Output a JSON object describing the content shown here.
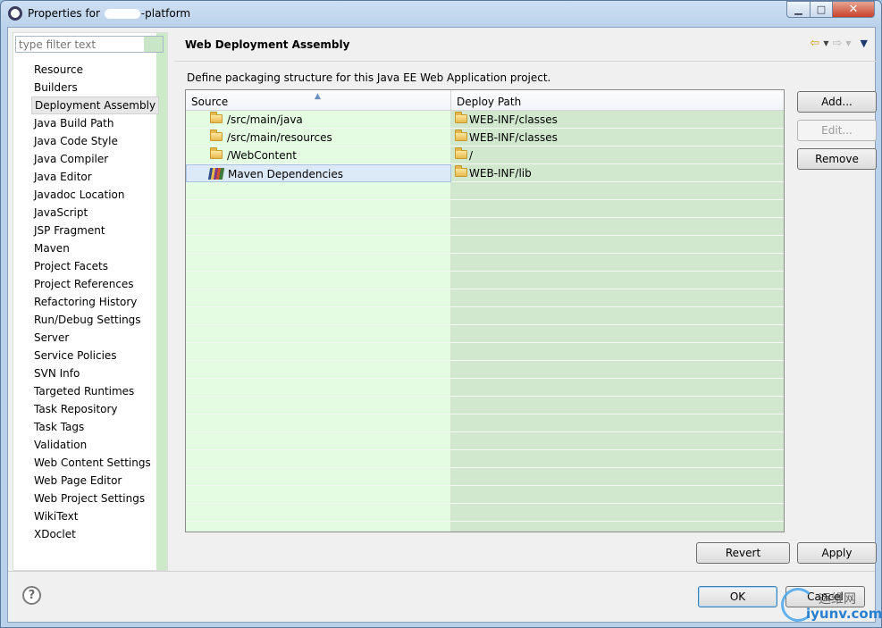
{
  "window": {
    "title_prefix": "Properties for",
    "title_suffix": "-platform",
    "controls": {
      "minimize": "▁",
      "maximize": "□",
      "close": "✕"
    }
  },
  "left_nav": {
    "filter_placeholder": "type filter text",
    "items": [
      "Resource",
      "Builders",
      "Deployment Assembly",
      "Java Build Path",
      "Java Code Style",
      "Java Compiler",
      "Java Editor",
      "Javadoc Location",
      "JavaScript",
      "JSP Fragment",
      "Maven",
      "Project Facets",
      "Project References",
      "Refactoring History",
      "Run/Debug Settings",
      "Server",
      "Service Policies",
      "SVN Info",
      "Targeted Runtimes",
      "Task Repository",
      "Task Tags",
      "Validation",
      "Web Content Settings",
      "Web Page Editor",
      "Web Project Settings",
      "WikiText",
      "XDoclet"
    ],
    "selected": "Deployment Assembly"
  },
  "page": {
    "title": "Web Deployment Assembly",
    "description": "Define packaging structure for this Java EE Web Application project.",
    "nav_icons": {
      "back": "back-arrow-icon",
      "forward": "forward-arrow-icon",
      "menu": "view-menu-icon"
    }
  },
  "table": {
    "columns": {
      "source": "Source",
      "deploy_path": "Deploy Path"
    },
    "rows": [
      {
        "source": "/src/main/java",
        "deploy_path": "WEB-INF/classes",
        "icon": "folder-icon"
      },
      {
        "source": "/src/main/resources",
        "deploy_path": "WEB-INF/classes",
        "icon": "folder-icon"
      },
      {
        "source": "/WebContent",
        "deploy_path": "/",
        "icon": "folder-icon"
      },
      {
        "source": "Maven Dependencies",
        "deploy_path": "WEB-INF/lib",
        "icon": "library-icon",
        "selected": true
      }
    ]
  },
  "buttons": {
    "add": "Add...",
    "edit": "Edit...",
    "remove": "Remove",
    "revert": "Revert",
    "apply": "Apply",
    "ok": "OK",
    "cancel": "Cancel"
  },
  "watermark": {
    "text_cn": "运维网",
    "url": "iyunv.com"
  },
  "colors": {
    "source_column_bg": "#e4fce1",
    "deploy_column_bg": "#d1e8ce",
    "selection_bg": "#dce9f7",
    "titlebar": "#b9d1ea"
  }
}
